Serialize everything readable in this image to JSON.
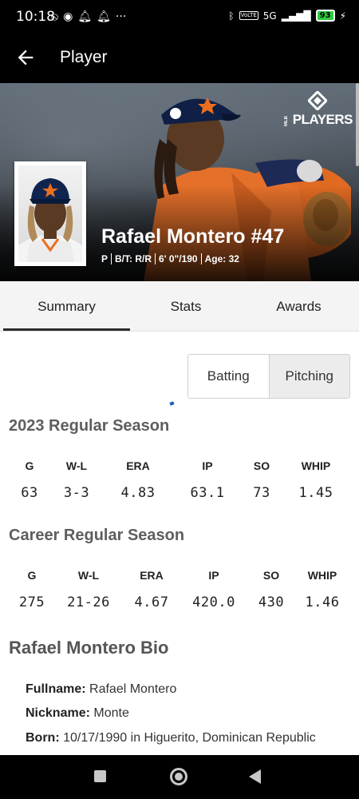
{
  "status_bar": {
    "time": "10:18",
    "icons_left": [
      "wifi-off-icon",
      "messenger-icon",
      "bell-icon",
      "bell-icon",
      "more-icon"
    ],
    "icons_right": [
      "bluetooth-icon",
      "volte-icon",
      "signal-icon",
      "battery-icon",
      "charging-icon"
    ],
    "volte_label": "VoLTE",
    "network": "5G",
    "battery": "93"
  },
  "app_bar": {
    "title": "Player"
  },
  "hero": {
    "logo_text": "PLAYERS",
    "logo_small": "MLB",
    "player_name": "Rafael Montero #47",
    "meta": [
      "P",
      "B/T: R/R",
      "6' 0\"/190",
      "Age: 32"
    ]
  },
  "tabs": [
    {
      "label": "Summary",
      "active": true
    },
    {
      "label": "Stats",
      "active": false
    },
    {
      "label": "Awards",
      "active": false
    }
  ],
  "toggle": {
    "batting": "Batting",
    "pitching": "Pitching",
    "selected": "Pitching"
  },
  "season_2023": {
    "title": "2023 Regular Season",
    "headers": [
      "G",
      "W-L",
      "ERA",
      "IP",
      "SO",
      "WHIP"
    ],
    "values": [
      "63",
      "3-3",
      "4.83",
      "63.1",
      "73",
      "1.45"
    ]
  },
  "career": {
    "title": "Career Regular Season",
    "headers": [
      "G",
      "W-L",
      "ERA",
      "IP",
      "SO",
      "WHIP"
    ],
    "values": [
      "275",
      "21-26",
      "4.67",
      "420.0",
      "430",
      "1.46"
    ]
  },
  "bio": {
    "title": "Rafael Montero Bio",
    "lines": [
      {
        "label": "Fullname:",
        "value": "Rafael Montero"
      },
      {
        "label": "Nickname:",
        "value": "Monte"
      },
      {
        "label": "Born:",
        "value": "10/17/1990 in Higuerito, Dominican Republic"
      }
    ]
  },
  "colors": {
    "accent": "#1a5fb4",
    "astros_orange": "#eb6e1f",
    "astros_navy": "#002d62",
    "battery_green": "#2ecc40"
  }
}
